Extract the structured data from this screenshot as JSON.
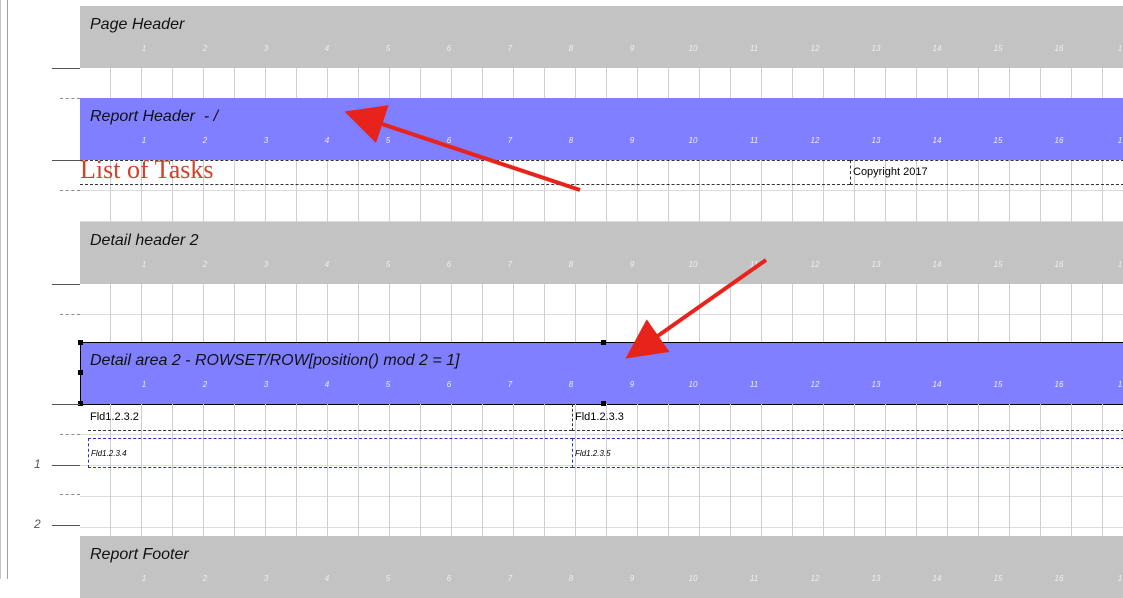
{
  "ruler_numbers": [
    "1",
    "2",
    "3",
    "4",
    "5",
    "6",
    "7",
    "8",
    "9",
    "10",
    "11",
    "12",
    "13",
    "14",
    "15",
    "16",
    "1"
  ],
  "bands": {
    "page_header": {
      "title": "Page Header"
    },
    "report_header": {
      "title": "Report Header  - /"
    },
    "detail_header": {
      "title": "Detail header 2"
    },
    "detail_area": {
      "title": "Detail area 2 - ROWSET/ROW[position() mod 2 = 1]"
    },
    "report_footer": {
      "title": "Report Footer"
    }
  },
  "report_header_fields": {
    "title_text": "List of Tasks",
    "copyright": "Copyright 2017"
  },
  "detail_fields": {
    "f1": "Fld1.2.3.2",
    "f2": "Fld1.2.3.3",
    "f3": "Fld1.2.3.4",
    "f4": "Fld1.2.3.5"
  },
  "side_numbers": {
    "one": "1",
    "two": "2"
  },
  "colors": {
    "band_gray": "#c3c3c3",
    "band_blue": "#7f7fff",
    "arrow": "#e8231b",
    "title_text": "#d0402a"
  }
}
